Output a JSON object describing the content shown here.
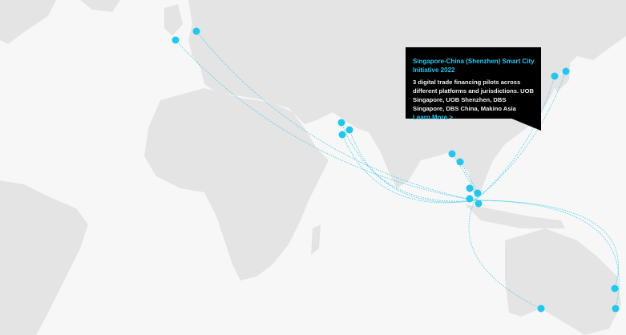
{
  "colors": {
    "accent": "#1ec8f0",
    "land": "#e4e4e4",
    "ocean": "#f7f7f7",
    "tooltip_bg": "#000000"
  },
  "tooltip": {
    "title": "Singapore-China (Shenzhen) Smart City Initiative 2022",
    "body": "3 digital trade financing pilots across different platforms and jurisdictions. UOB Singapore, UOB Shenzhen, DBS Singapore, DBS China, Makino Asia",
    "link": "Learn More >"
  },
  "markers_count": 16
}
